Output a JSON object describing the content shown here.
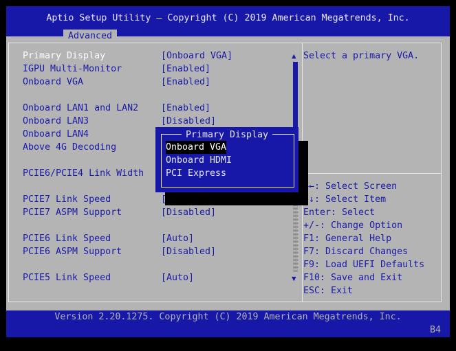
{
  "header": {
    "title": "Aptio Setup Utility – Copyright (C) 2019 American Megatrends, Inc.",
    "active_tab": "Advanced"
  },
  "settings": [
    {
      "label": "Primary Display",
      "value": "[Onboard VGA]"
    },
    {
      "label": "IGPU Multi-Monitor",
      "value": "[Enabled]"
    },
    {
      "label": "Onboard VGA",
      "value": "[Enabled]"
    },
    {
      "label": "Onboard LAN1 and LAN2",
      "value": "[Enabled]"
    },
    {
      "label": "Onboard LAN3",
      "value": "[Disabled]"
    },
    {
      "label": "Onboard LAN4",
      "value": ""
    },
    {
      "label": "Above 4G Decoding",
      "value": ""
    },
    {
      "label": "PCIE6/PCIE4 Link Width",
      "value": ""
    },
    {
      "label": "PCIE7 Link Speed",
      "value": "["
    },
    {
      "label": "PCIE7 ASPM Support",
      "value": "[Disabled]"
    },
    {
      "label": "PCIE6 Link Speed",
      "value": "[Auto]"
    },
    {
      "label": "PCIE6 ASPM Support",
      "value": "[Disabled]"
    },
    {
      "label": "PCIE5 Link Speed",
      "value": "[Auto]"
    }
  ],
  "help": {
    "description": "Select a primary VGA.",
    "keys": [
      "→←: Select Screen",
      "↑↓: Select Item",
      "Enter: Select",
      "+/-: Change Option",
      "F1: General Help",
      "F7: Discard Changes",
      "F9: Load UEFI Defaults",
      "F10: Save and Exit",
      "ESC: Exit"
    ]
  },
  "popup": {
    "title": "Primary Display",
    "options": [
      "Onboard VGA",
      "Onboard HDMI",
      "PCI Express"
    ],
    "selected_index": 0
  },
  "footer": {
    "version": "Version 2.20.1275. Copyright (C) 2019 American Megatrends, Inc.",
    "code": "B4"
  },
  "colors": {
    "bios_blue": "#1818a8",
    "bios_gray": "#b4b4b4",
    "text_white": "#e8e8e8"
  },
  "icons": {
    "scroll_up": "▲",
    "scroll_down": "▼"
  }
}
